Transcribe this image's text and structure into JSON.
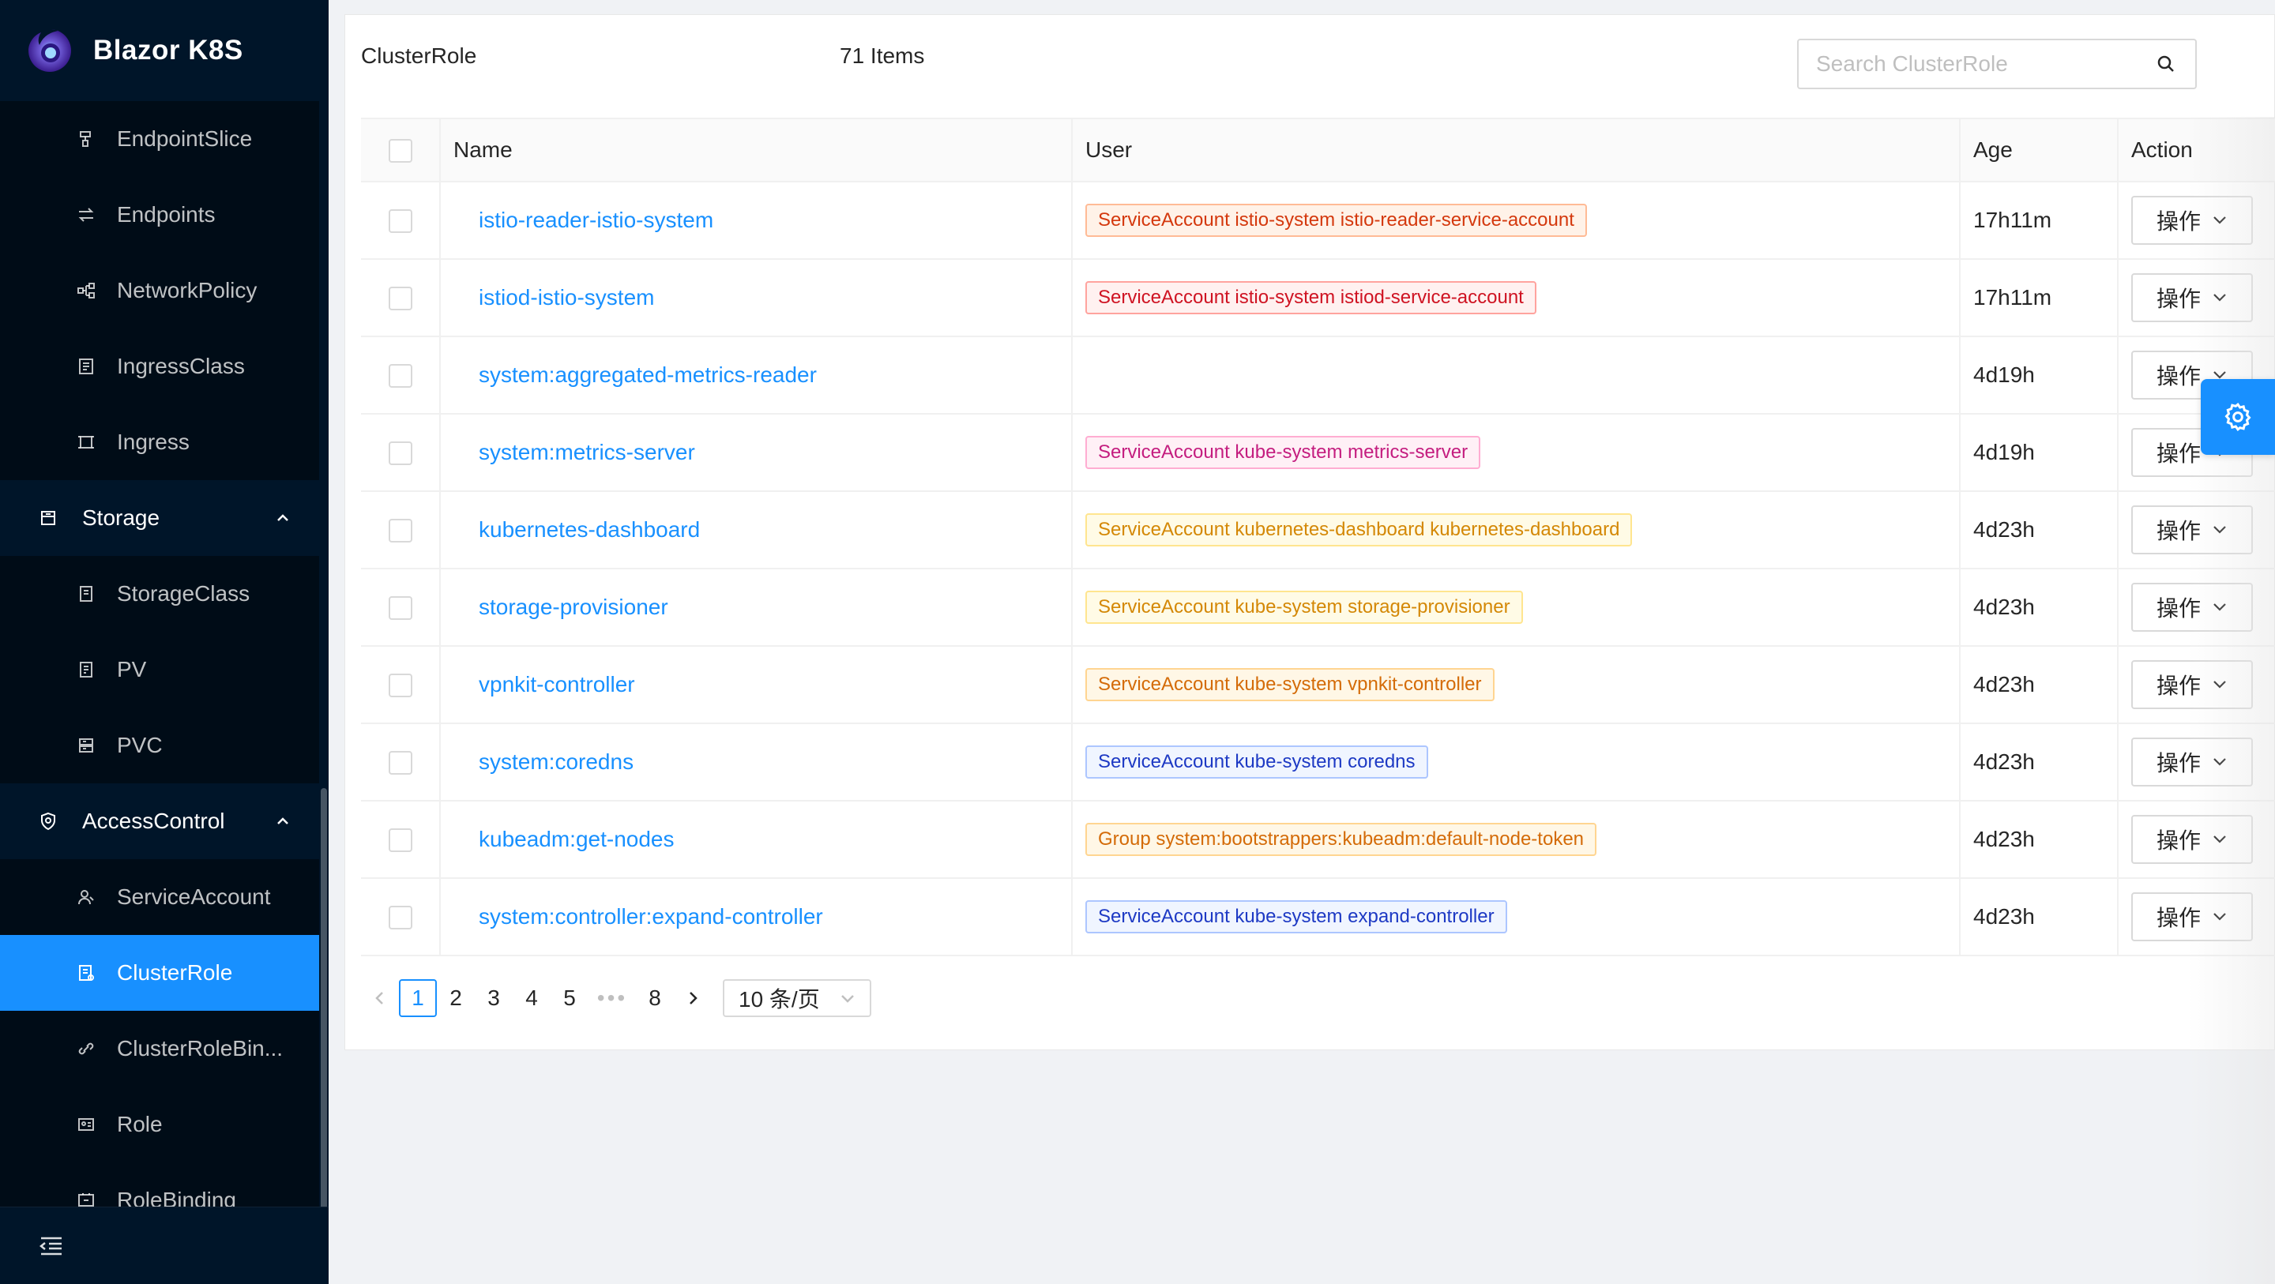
{
  "app": {
    "title": "Blazor K8S"
  },
  "sidebar": {
    "items": [
      {
        "label": "EndpointSlice",
        "icon": "endpointslice-icon"
      },
      {
        "label": "Endpoints",
        "icon": "endpoints-icon"
      },
      {
        "label": "NetworkPolicy",
        "icon": "network-policy-icon"
      },
      {
        "label": "IngressClass",
        "icon": "ingress-class-icon"
      },
      {
        "label": "Ingress",
        "icon": "ingress-icon"
      }
    ],
    "storage_group": {
      "label": "Storage",
      "icon": "storage-icon"
    },
    "storage_items": [
      {
        "label": "StorageClass",
        "icon": "storageclass-icon"
      },
      {
        "label": "PV",
        "icon": "pv-icon"
      },
      {
        "label": "PVC",
        "icon": "pvc-icon"
      }
    ],
    "access_group": {
      "label": "AccessControl",
      "icon": "shield-icon"
    },
    "access_items": [
      {
        "label": "ServiceAccount",
        "icon": "service-account-icon"
      },
      {
        "label": "ClusterRole",
        "icon": "cluster-role-icon",
        "active": true
      },
      {
        "label": "ClusterRoleBin...",
        "icon": "cluster-role-binding-icon"
      },
      {
        "label": "Role",
        "icon": "role-icon"
      },
      {
        "label": "RoleBinding",
        "icon": "role-binding-icon"
      }
    ]
  },
  "header": {
    "title": "ClusterRole",
    "count": "71 Items",
    "search_placeholder": "Search ClusterRole"
  },
  "table": {
    "columns": {
      "name": "Name",
      "user": "User",
      "age": "Age",
      "action": "Action"
    },
    "action_label": "操作",
    "rows": [
      {
        "name": "istio-reader-istio-system",
        "user": "ServiceAccount istio-system istio-reader-service-account",
        "tag_color": "volcano",
        "age": "17h11m"
      },
      {
        "name": "istiod-istio-system",
        "user": "ServiceAccount istio-system istiod-service-account",
        "tag_color": "red",
        "age": "17h11m"
      },
      {
        "name": "system:aggregated-metrics-reader",
        "user": "",
        "tag_color": "",
        "age": "4d19h"
      },
      {
        "name": "system:metrics-server",
        "user": "ServiceAccount kube-system metrics-server",
        "tag_color": "magenta",
        "age": "4d19h"
      },
      {
        "name": "kubernetes-dashboard",
        "user": "ServiceAccount kubernetes-dashboard kubernetes-dashboard",
        "tag_color": "gold",
        "age": "4d23h"
      },
      {
        "name": "storage-provisioner",
        "user": "ServiceAccount kube-system storage-provisioner",
        "tag_color": "gold",
        "age": "4d23h"
      },
      {
        "name": "vpnkit-controller",
        "user": "ServiceAccount kube-system vpnkit-controller",
        "tag_color": "orange",
        "age": "4d23h"
      },
      {
        "name": "system:coredns",
        "user": "ServiceAccount kube-system coredns",
        "tag_color": "geekblue",
        "age": "4d23h"
      },
      {
        "name": "kubeadm:get-nodes",
        "user": "Group system:bootstrappers:kubeadm:default-node-token",
        "tag_color": "orange",
        "age": "4d23h"
      },
      {
        "name": "system:controller:expand-controller",
        "user": "ServiceAccount kube-system expand-controller",
        "tag_color": "geekblue",
        "age": "4d23h"
      }
    ]
  },
  "pagination": {
    "pages": [
      "1",
      "2",
      "3",
      "4",
      "5"
    ],
    "ellipsis": "•••",
    "last_page": "8",
    "current": "1",
    "page_size": "10 条/页"
  },
  "colors": {
    "primary": "#1890ff",
    "sidebar_bg": "#001529",
    "submenu_bg": "#000c17"
  }
}
